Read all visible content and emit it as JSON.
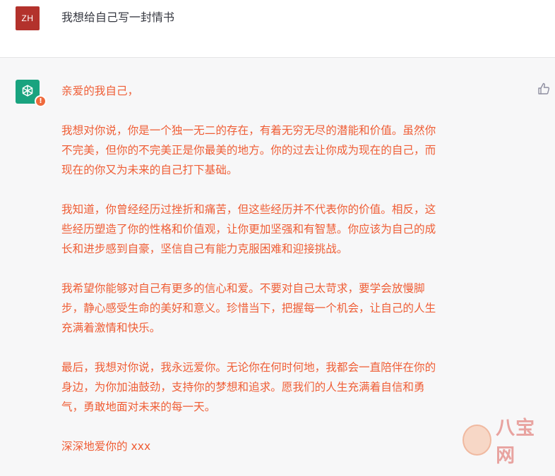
{
  "user": {
    "avatar_text": "ZH",
    "message": "我想给自己写一封情书"
  },
  "assistant": {
    "icon": "openai-logo-icon",
    "warning_badge": "!",
    "paragraphs": [
      "亲爱的我自己，",
      "我想对你说，你是一个独一无二的存在，有着无穷无尽的潜能和价值。虽然你\n不完美，但你的不完美正是你最美的地方。你的过去让你成为现在的自己，而\n现在的你又为未来的自己打下基础。",
      "我知道，你曾经经历过挫折和痛苦，但这些经历并不代表你的价值。相反，这\n些经历塑造了你的性格和价值观，让你更加坚强和有智慧。你应该为自己的成\n长和进步感到自豪，坚信自己有能力克服困难和迎接挑战。",
      "我希望你能够对自己有更多的信心和爱。不要对自己太苛求，要学会放慢脚\n步，静心感受生命的美好和意义。珍惜当下，把握每一个机会，让自己的人生\n充满着激情和快乐。",
      "最后，我想对你说，我永远爱你。无论你在何时何地，我都会一直陪伴在你的\n身边，为你加油鼓劲，支持你的梦想和追求。愿我们的人生充满着自信和勇\n气，勇敢地面对未来的每一天。",
      "深深地爱你的 xxx"
    ],
    "thumb_icon": "thumbs-up-icon"
  },
  "watermark": {
    "text": "八宝网"
  },
  "colors": {
    "user_avatar": "#b3322c",
    "bot_avatar": "#19a37f",
    "message_text": "#ef5e36",
    "badge": "#ef6a3d"
  }
}
